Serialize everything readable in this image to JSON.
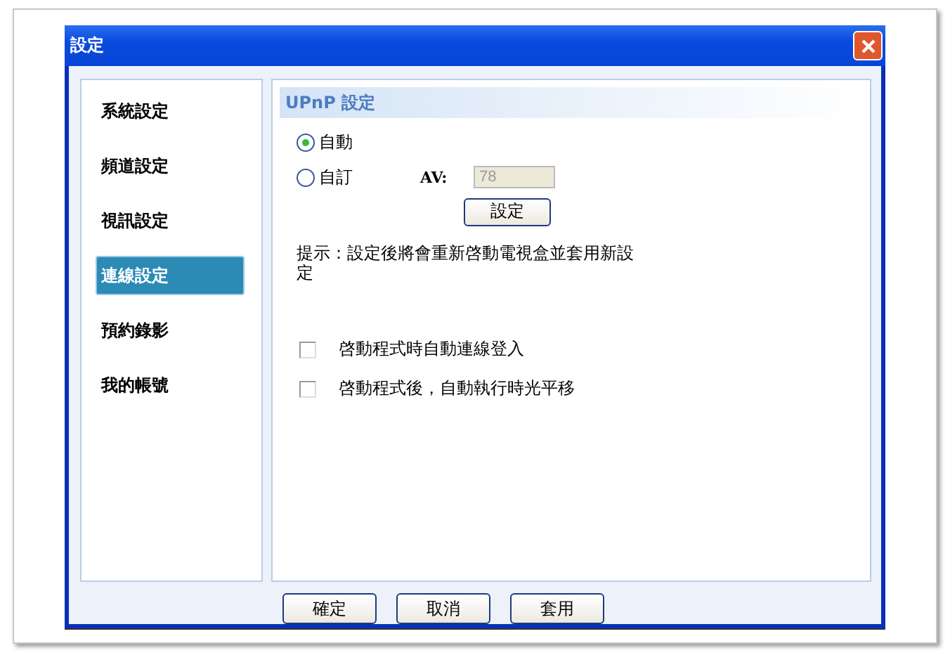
{
  "window": {
    "title": "設定"
  },
  "sidebar": {
    "items": [
      {
        "label": "系統設定",
        "selected": false
      },
      {
        "label": "頻道設定",
        "selected": false
      },
      {
        "label": "視訊設定",
        "selected": false
      },
      {
        "label": "連線設定",
        "selected": true
      },
      {
        "label": "預約錄影",
        "selected": false
      },
      {
        "label": "我的帳號",
        "selected": false
      }
    ]
  },
  "section": {
    "title": "UPnP 設定"
  },
  "mode_options": [
    {
      "label": "自動",
      "selected": true
    },
    {
      "label": "自訂",
      "selected": false
    }
  ],
  "av_field": {
    "label": "AV:",
    "value": "78",
    "disabled": true
  },
  "set_button": "設定",
  "hint": "提示：設定後將會重新啓動電視盒並套用新設定",
  "options": [
    {
      "label": "啓動程式時自動連線登入",
      "checked": false
    },
    {
      "label": "啓動程式後，自動執行時光平移",
      "checked": false
    }
  ],
  "buttons": [
    "確定",
    "取消",
    "套用"
  ]
}
